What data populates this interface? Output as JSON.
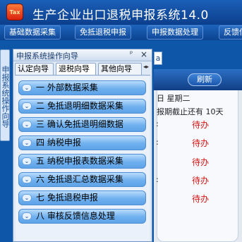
{
  "app": {
    "title": "生产企业出口退税申报系统14.0",
    "icon_text": "Tax"
  },
  "menu": [
    "基础数据采集",
    "免抵退税申报",
    "申报数据处理",
    "反馈信"
  ],
  "side_tab": "申报系统操作向导",
  "wizard": {
    "title": "申报系统操作向导",
    "pin": "ᵖ",
    "close": "×",
    "tabs": [
      "认定向导",
      "退税向导",
      "其他向导"
    ],
    "active_tab": 1,
    "items": [
      {
        "num": "一",
        "label": "外部数据采集"
      },
      {
        "num": "二",
        "label": "免抵退明细数据采集"
      },
      {
        "num": "三",
        "label": "确认免抵退明细数据"
      },
      {
        "num": "四",
        "label": "纳税申报"
      },
      {
        "num": "五",
        "label": "纳税申报表数据采集"
      },
      {
        "num": "六",
        "label": "免抵退汇总数据采集"
      },
      {
        "num": "七",
        "label": "免抵退税申报"
      },
      {
        "num": "八",
        "label": "审核反馈信息处理"
      }
    ]
  },
  "right_panel": {
    "tab_partial": "a",
    "refresh": "刷新",
    "date_line": "日 星期二",
    "deadline_line": "报期截止还有 10天",
    "colons": [
      ":",
      ":",
      ":"
    ],
    "status": [
      "待办",
      "待办",
      "待办",
      "待办",
      "待办"
    ]
  },
  "colors": {
    "title_bg": "#0c3f8d",
    "item_bg": "#6fb0ef",
    "todo_text": "#d41616"
  }
}
